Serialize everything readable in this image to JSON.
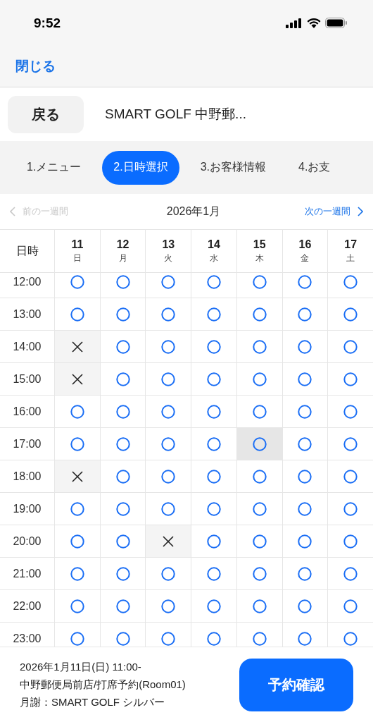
{
  "status_bar": {
    "time": "9:52"
  },
  "nav": {
    "close": "閉じる"
  },
  "header": {
    "back": "戻る",
    "title": "SMART GOLF 中野郵..."
  },
  "steps": [
    {
      "label": "1.メニュー",
      "selected": false
    },
    {
      "label": "2.日時選択",
      "selected": true
    },
    {
      "label": "3.お客様情報",
      "selected": false
    },
    {
      "label": "4.お支",
      "selected": false
    }
  ],
  "week_nav": {
    "prev": {
      "label": "前の一週間",
      "disabled": true
    },
    "month": "2026年1月",
    "next": {
      "label": "次の一週間",
      "disabled": false
    }
  },
  "table": {
    "corner": "日時",
    "days": [
      {
        "date": "11",
        "weekday": "日"
      },
      {
        "date": "12",
        "weekday": "月"
      },
      {
        "date": "13",
        "weekday": "火"
      },
      {
        "date": "14",
        "weekday": "水"
      },
      {
        "date": "15",
        "weekday": "木"
      },
      {
        "date": "16",
        "weekday": "金"
      },
      {
        "date": "17",
        "weekday": "土"
      }
    ],
    "rows": [
      {
        "time": "12:00",
        "slots": [
          {
            "available": true,
            "highlighted": false
          },
          {
            "available": true,
            "highlighted": false
          },
          {
            "available": true,
            "highlighted": false
          },
          {
            "available": true,
            "highlighted": false
          },
          {
            "available": true,
            "highlighted": false
          },
          {
            "available": true,
            "highlighted": false
          },
          {
            "available": true,
            "highlighted": false
          }
        ]
      },
      {
        "time": "13:00",
        "slots": [
          {
            "available": true,
            "highlighted": false
          },
          {
            "available": true,
            "highlighted": false
          },
          {
            "available": true,
            "highlighted": false
          },
          {
            "available": true,
            "highlighted": false
          },
          {
            "available": true,
            "highlighted": false
          },
          {
            "available": true,
            "highlighted": false
          },
          {
            "available": true,
            "highlighted": false
          }
        ]
      },
      {
        "time": "14:00",
        "slots": [
          {
            "available": false,
            "highlighted": false
          },
          {
            "available": true,
            "highlighted": false
          },
          {
            "available": true,
            "highlighted": false
          },
          {
            "available": true,
            "highlighted": false
          },
          {
            "available": true,
            "highlighted": false
          },
          {
            "available": true,
            "highlighted": false
          },
          {
            "available": true,
            "highlighted": false
          }
        ]
      },
      {
        "time": "15:00",
        "slots": [
          {
            "available": false,
            "highlighted": false
          },
          {
            "available": true,
            "highlighted": false
          },
          {
            "available": true,
            "highlighted": false
          },
          {
            "available": true,
            "highlighted": false
          },
          {
            "available": true,
            "highlighted": false
          },
          {
            "available": true,
            "highlighted": false
          },
          {
            "available": true,
            "highlighted": false
          }
        ]
      },
      {
        "time": "16:00",
        "slots": [
          {
            "available": true,
            "highlighted": false
          },
          {
            "available": true,
            "highlighted": false
          },
          {
            "available": true,
            "highlighted": false
          },
          {
            "available": true,
            "highlighted": false
          },
          {
            "available": true,
            "highlighted": false
          },
          {
            "available": true,
            "highlighted": false
          },
          {
            "available": true,
            "highlighted": false
          }
        ]
      },
      {
        "time": "17:00",
        "slots": [
          {
            "available": true,
            "highlighted": false
          },
          {
            "available": true,
            "highlighted": false
          },
          {
            "available": true,
            "highlighted": false
          },
          {
            "available": true,
            "highlighted": false
          },
          {
            "available": true,
            "highlighted": true
          },
          {
            "available": true,
            "highlighted": false
          },
          {
            "available": true,
            "highlighted": false
          }
        ]
      },
      {
        "time": "18:00",
        "slots": [
          {
            "available": false,
            "highlighted": false
          },
          {
            "available": true,
            "highlighted": false
          },
          {
            "available": true,
            "highlighted": false
          },
          {
            "available": true,
            "highlighted": false
          },
          {
            "available": true,
            "highlighted": false
          },
          {
            "available": true,
            "highlighted": false
          },
          {
            "available": true,
            "highlighted": false
          }
        ]
      },
      {
        "time": "19:00",
        "slots": [
          {
            "available": true,
            "highlighted": false
          },
          {
            "available": true,
            "highlighted": false
          },
          {
            "available": true,
            "highlighted": false
          },
          {
            "available": true,
            "highlighted": false
          },
          {
            "available": true,
            "highlighted": false
          },
          {
            "available": true,
            "highlighted": false
          },
          {
            "available": true,
            "highlighted": false
          }
        ]
      },
      {
        "time": "20:00",
        "slots": [
          {
            "available": true,
            "highlighted": false
          },
          {
            "available": true,
            "highlighted": false
          },
          {
            "available": false,
            "highlighted": false
          },
          {
            "available": true,
            "highlighted": false
          },
          {
            "available": true,
            "highlighted": false
          },
          {
            "available": true,
            "highlighted": false
          },
          {
            "available": true,
            "highlighted": false
          }
        ]
      },
      {
        "time": "21:00",
        "slots": [
          {
            "available": true,
            "highlighted": false
          },
          {
            "available": true,
            "highlighted": false
          },
          {
            "available": true,
            "highlighted": false
          },
          {
            "available": true,
            "highlighted": false
          },
          {
            "available": true,
            "highlighted": false
          },
          {
            "available": true,
            "highlighted": false
          },
          {
            "available": true,
            "highlighted": false
          }
        ]
      },
      {
        "time": "22:00",
        "slots": [
          {
            "available": true,
            "highlighted": false
          },
          {
            "available": true,
            "highlighted": false
          },
          {
            "available": true,
            "highlighted": false
          },
          {
            "available": true,
            "highlighted": false
          },
          {
            "available": true,
            "highlighted": false
          },
          {
            "available": true,
            "highlighted": false
          },
          {
            "available": true,
            "highlighted": false
          }
        ]
      },
      {
        "time": "23:00",
        "slots": [
          {
            "available": true,
            "highlighted": false
          },
          {
            "available": true,
            "highlighted": false
          },
          {
            "available": true,
            "highlighted": false
          },
          {
            "available": true,
            "highlighted": false
          },
          {
            "available": true,
            "highlighted": false
          },
          {
            "available": true,
            "highlighted": false
          },
          {
            "available": true,
            "highlighted": false
          }
        ]
      }
    ]
  },
  "footer": {
    "lines": [
      "2026年1月11日(日) 11:00-",
      "中野郵便局前店/打席予約(Room01)",
      "月謝：SMART GOLF シルバー"
    ],
    "confirm": "予約確認"
  }
}
